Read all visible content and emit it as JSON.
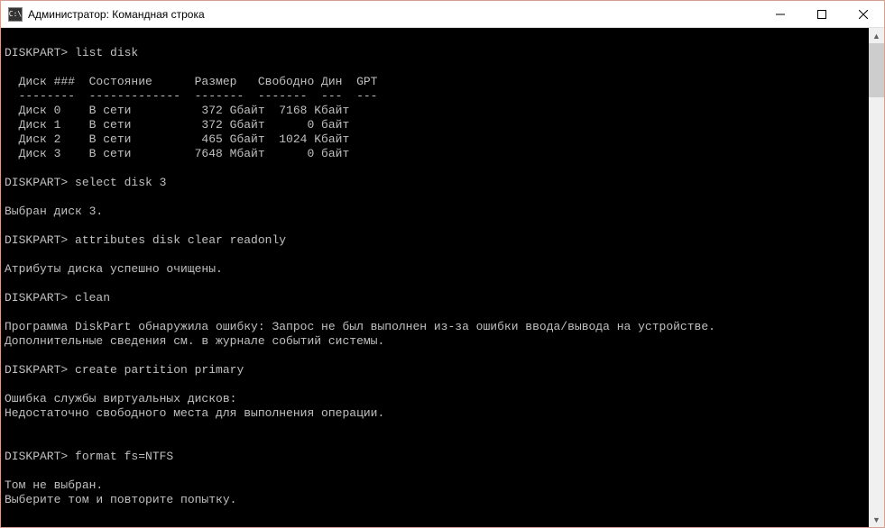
{
  "window": {
    "title": "Администратор: Командная строка"
  },
  "terminal": {
    "lines": [
      "",
      "DISKPART> list disk",
      "",
      "  Диск ###  Состояние      Размер   Свободно Дин  GPT",
      "  --------  -------------  -------  -------  ---  ---",
      "  Диск 0    В сети          372 Gбайт  7168 Kбайт",
      "  Диск 1    В сети          372 Gбайт      0 байт",
      "  Диск 2    В сети          465 Gбайт  1024 Kбайт",
      "  Диск 3    В сети         7648 Mбайт      0 байт",
      "",
      "DISKPART> select disk 3",
      "",
      "Выбран диск 3.",
      "",
      "DISKPART> attributes disk clear readonly",
      "",
      "Атрибуты диска успешно очищены.",
      "",
      "DISKPART> clean",
      "",
      "Программа DiskPart обнаружила ошибку: Запрос не был выполнен из-за ошибки ввода/вывода на устройстве.",
      "Дополнительные сведения см. в журнале событий системы.",
      "",
      "DISKPART> create partition primary",
      "",
      "Ошибка службы виртуальных дисков:",
      "Недостаточно свободного места для выполнения операции.",
      "",
      "",
      "DISKPART> format fs=NTFS",
      "",
      "Том не выбран.",
      "Выберите том и повторите попытку."
    ]
  }
}
